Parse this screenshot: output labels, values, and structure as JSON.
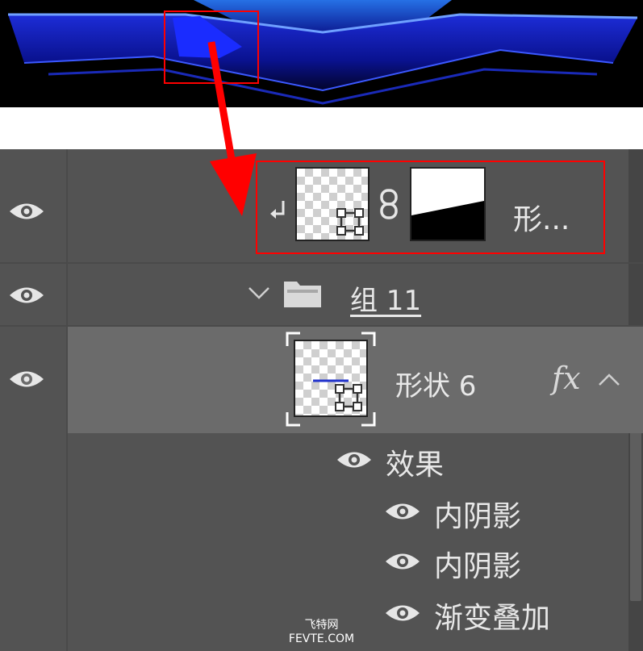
{
  "preview": {
    "accent_color": "#1a2cff",
    "highlight_color": "#ff0000"
  },
  "layers": {
    "clipped_layer": {
      "name": "形..."
    },
    "group": {
      "name": "组 11"
    },
    "shape_layer": {
      "name": "形状 6",
      "fx_label": "fx"
    },
    "effects": {
      "header": "效果",
      "items": [
        {
          "label": "内阴影"
        },
        {
          "label": "内阴影"
        },
        {
          "label": "渐变叠加"
        }
      ]
    }
  },
  "watermark": {
    "line1": "飞特网",
    "line2": "FEVTE.COM"
  }
}
